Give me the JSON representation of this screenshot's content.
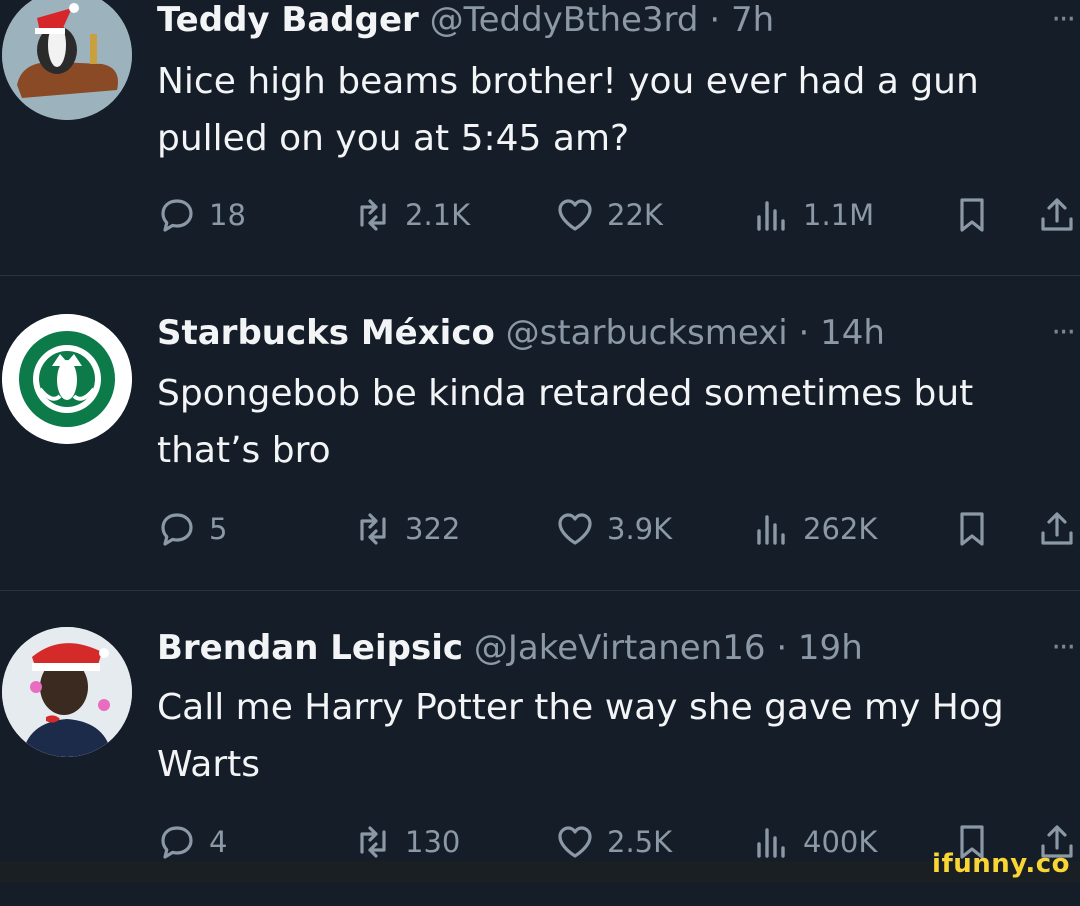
{
  "tweets": [
    {
      "name": "Teddy Badger",
      "handle": "@TeddyBthe3rd",
      "time": "· 7h",
      "text": "Nice high beams brother! you ever had a gun pulled on you at 5:45 am?",
      "replies": "18",
      "reposts": "2.1K",
      "likes": "22K",
      "views": "1.1M"
    },
    {
      "name": "Starbucks México",
      "handle": "@starbucksmexi",
      "time": "· 14h",
      "text": "Spongebob be kinda retarded sometimes but that’s bro",
      "replies": "5",
      "reposts": "322",
      "likes": "3.9K",
      "views": "262K"
    },
    {
      "name": "Brendan Leipsic",
      "handle": "@JakeVirtanen16",
      "time": "· 19h",
      "text": "Call me Harry Potter the way she gave my Hog Warts",
      "replies": "4",
      "reposts": "130",
      "likes": "2.5K",
      "views": "400K"
    }
  ],
  "more_glyph": "···",
  "watermark": "ifunny.co",
  "colors": {
    "background": "#151d28",
    "muted": "#8b98a5",
    "watermark": "#f9d535"
  }
}
